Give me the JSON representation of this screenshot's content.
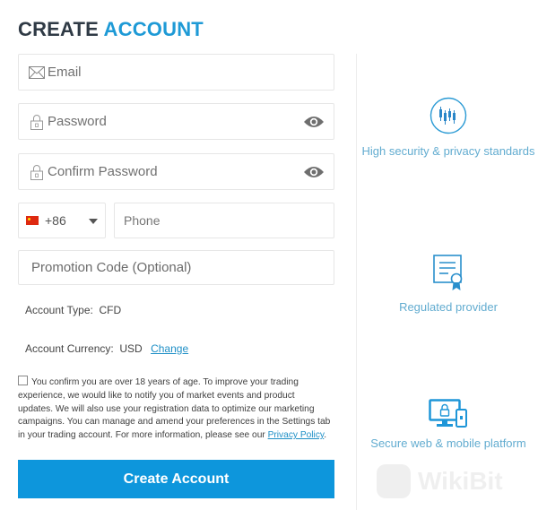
{
  "header": {
    "title_part1": "CREATE",
    "title_part2": "ACCOUNT"
  },
  "form": {
    "email": {
      "placeholder": "Email",
      "icon": "envelope-icon"
    },
    "password": {
      "placeholder": "Password",
      "icon": "lock-icon",
      "toggle_icon": "eye-icon"
    },
    "confirm_password": {
      "placeholder": "Confirm Password",
      "icon": "lock-icon",
      "toggle_icon": "eye-icon"
    },
    "country_code": {
      "selected": "+86",
      "flag": "china-flag-icon"
    },
    "phone": {
      "placeholder": "Phone"
    },
    "promotion_code": {
      "placeholder": "Promotion Code (Optional)"
    },
    "account_type": {
      "label": "Account Type:",
      "value": "CFD"
    },
    "account_currency": {
      "label": "Account Currency:",
      "value": "USD",
      "change_link": "Change"
    },
    "consent": {
      "checked": false,
      "text": "You confirm you are over 18 years of age. To improve your trading experience, we would like to notify you of market events and product updates. We will also use your registration data to optimize our marketing campaigns. You can manage and amend your preferences in the Settings tab in your trading account. For more information, please see our ",
      "link": "Privacy Policy",
      "suffix": "."
    },
    "submit_label": "Create Account"
  },
  "features": [
    {
      "icon": "candlestick-chart-icon",
      "label": "High security & privacy standards"
    },
    {
      "icon": "certificate-icon",
      "label": "Regulated provider"
    },
    {
      "icon": "desktop-mobile-lock-icon",
      "label": "Secure web & mobile platform"
    }
  ],
  "watermark": {
    "text": "WikiBit"
  },
  "colors": {
    "accent": "#1e9ad6",
    "button": "#0d96dc",
    "title_dark": "#2f3a45",
    "feature_text": "#62acd0",
    "link": "#1e8fc6"
  }
}
